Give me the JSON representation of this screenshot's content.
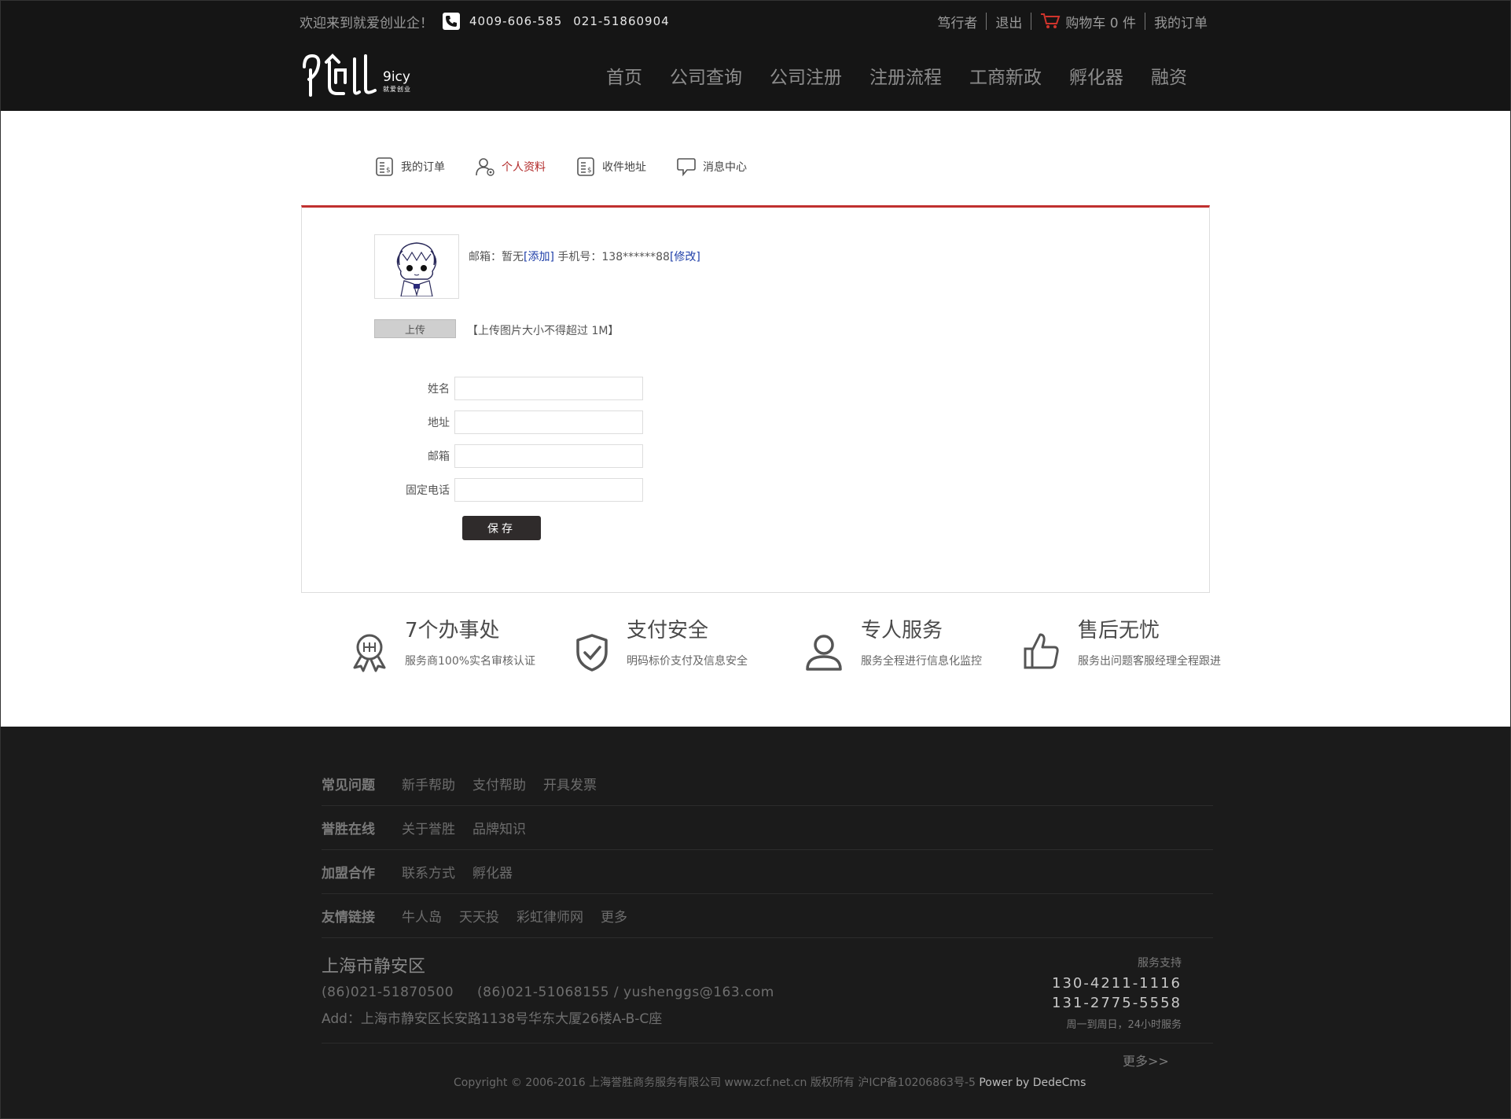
{
  "topbar": {
    "welcome": "欢迎来到就爱创业企！",
    "phone1": "4009-606-585",
    "phone2": "021-51860904",
    "user": "笃行者",
    "logout": "退出",
    "cart": "购物车 0 件",
    "orders": "我的订单"
  },
  "logo": {
    "brand": "9icy",
    "tagline": "就爱创业"
  },
  "nav": [
    "首页",
    "公司查询",
    "公司注册",
    "注册流程",
    "工商新政",
    "孵化器",
    "融资"
  ],
  "tabs": [
    {
      "label": "我的订单",
      "icon": "order-icon"
    },
    {
      "label": "个人资料",
      "icon": "user-icon",
      "active": true
    },
    {
      "label": "收件地址",
      "icon": "address-icon"
    },
    {
      "label": "消息中心",
      "icon": "message-icon"
    }
  ],
  "profile": {
    "email_label": "邮箱：暂无",
    "add_link": "[添加]",
    "phone_label": " 手机号：138******88",
    "modify_link": "[修改]",
    "upload_label": "上传",
    "upload_note": "【上传图片大小不得超过 1M】"
  },
  "form": {
    "fields": [
      {
        "label": "姓名",
        "value": ""
      },
      {
        "label": "地址",
        "value": ""
      },
      {
        "label": "邮箱",
        "value": ""
      },
      {
        "label": "固定电话",
        "value": ""
      }
    ],
    "save": "保存"
  },
  "features": [
    {
      "title": "7个办事处",
      "desc": "服务商100%实名审核认证",
      "icon": "badge-icon"
    },
    {
      "title": "支付安全",
      "desc": "明码标价支付及信息安全",
      "icon": "shield-icon"
    },
    {
      "title": "专人服务",
      "desc": "服务全程进行信息化监控",
      "icon": "person-icon"
    },
    {
      "title": "售后无忧",
      "desc": "服务出问题客服经理全程跟进",
      "icon": "thumbs-up-icon"
    }
  ],
  "footer": {
    "rows": [
      {
        "heading": "常见问题",
        "links": [
          "新手帮助",
          "支付帮助",
          "开具发票"
        ]
      },
      {
        "heading": "誉胜在线",
        "links": [
          "关于誉胜",
          "品牌知识"
        ]
      },
      {
        "heading": "加盟合作",
        "links": [
          "联系方式",
          "孵化器"
        ]
      },
      {
        "heading": "友情链接",
        "links": [
          "牛人岛",
          "天天投",
          "彩虹律师网",
          "更多"
        ]
      }
    ],
    "address_title": "上海市静安区",
    "phone_a": "(86)021-51870500",
    "phone_b": "(86)021-51068155 / yushenggs@163.com",
    "address": "Add：上海市静安区长安路1138号华东大厦26楼A-B-C座",
    "service_label": "服务支持",
    "service_phone1": "130-4211-1116",
    "service_phone2": "131-2775-5558",
    "service_hours": "周一到周日，24小时服务",
    "more": "更多>>",
    "copyright": "Copyright © 2006-2016 上海誉胜商务服务有限公司 www.zcf.net.cn  版权所有  沪ICP备10206863号-5 ",
    "powered": "Power by DedeCms"
  },
  "colors": {
    "accent": "#c0302f",
    "header_bg": "#151515",
    "footer_bg": "#1b1b1b",
    "link": "#1e3ea8"
  }
}
